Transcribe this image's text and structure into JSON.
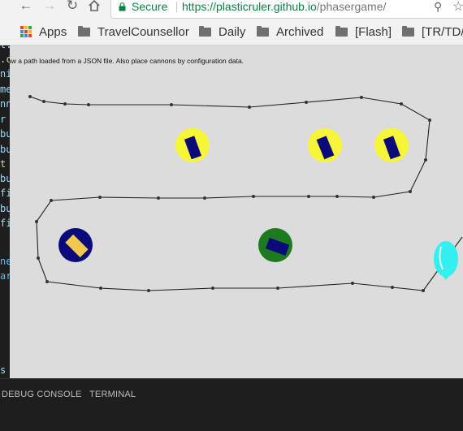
{
  "browser": {
    "secure_label": "Secure",
    "url_host": "https://plasticruler.github.io",
    "url_path": "/phasergame/",
    "bookmarks": [
      {
        "label": "Apps",
        "icon": "apps-icon"
      },
      {
        "label": "TravelCounsellor",
        "icon": "folder-icon"
      },
      {
        "label": "Daily",
        "icon": "folder-icon"
      },
      {
        "label": "Archived",
        "icon": "folder-icon"
      },
      {
        "label": "[Flash]",
        "icon": "folder-icon"
      },
      {
        "label": "[TR/TD/",
        "icon": "folder-icon"
      }
    ]
  },
  "editor": {
    "lines": [
      "t:",
      ".c",
      "ni",
      "me",
      "nn",
      "r",
      "bu",
      "bu",
      "t",
      "bu",
      "fi",
      "bu",
      "fi",
      "",
      "",
      "ne",
      "ar",
      "",
      "",
      "",
      "",
      "",
      "",
      "s"
    ]
  },
  "game": {
    "caption": "Draw a path loaded from a JSON file. Also place cannons by configuration data.",
    "colors": {
      "background": "#dcdcdc",
      "path": "#222222",
      "yellow": "#f7f538",
      "navy": "#0a0a7a",
      "green": "#1e7a1e",
      "balloon": "#33f0f0"
    },
    "cannons": [
      {
        "name": "yellow-cannon-1",
        "base": "yellow",
        "barrel": "navy"
      },
      {
        "name": "yellow-cannon-2",
        "base": "yellow",
        "barrel": "navy"
      },
      {
        "name": "yellow-cannon-3",
        "base": "yellow",
        "barrel": "navy"
      },
      {
        "name": "navy-cannon",
        "base": "navy",
        "barrel": "yellow"
      },
      {
        "name": "green-cannon",
        "base": "green",
        "barrel": "navy"
      }
    ]
  },
  "panel": {
    "tabs": [
      "DEBUG CONSOLE",
      "TERMINAL"
    ]
  }
}
